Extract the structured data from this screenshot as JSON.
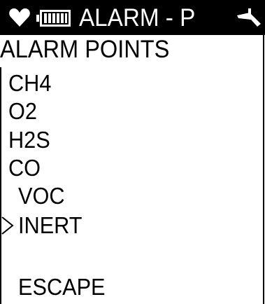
{
  "titlebar": {
    "title": "ALARM - P",
    "icons": [
      "heart-icon",
      "battery-icon",
      "pump-icon"
    ]
  },
  "section": {
    "header": "ALARM  POINTS"
  },
  "menu": {
    "items": [
      {
        "label": "CH4"
      },
      {
        "label": "O2"
      },
      {
        "label": "H2S"
      },
      {
        "label": "CO"
      },
      {
        "label": "VOC"
      },
      {
        "label": "INERT",
        "selected": true
      },
      {
        "label": "ESCAPE"
      }
    ],
    "selector_icon": "chevron-right-icon"
  },
  "colors": {
    "foreground": "#000000",
    "background": "#ffffff",
    "titlebar_bg": "#000000",
    "titlebar_fg": "#ffffff"
  }
}
